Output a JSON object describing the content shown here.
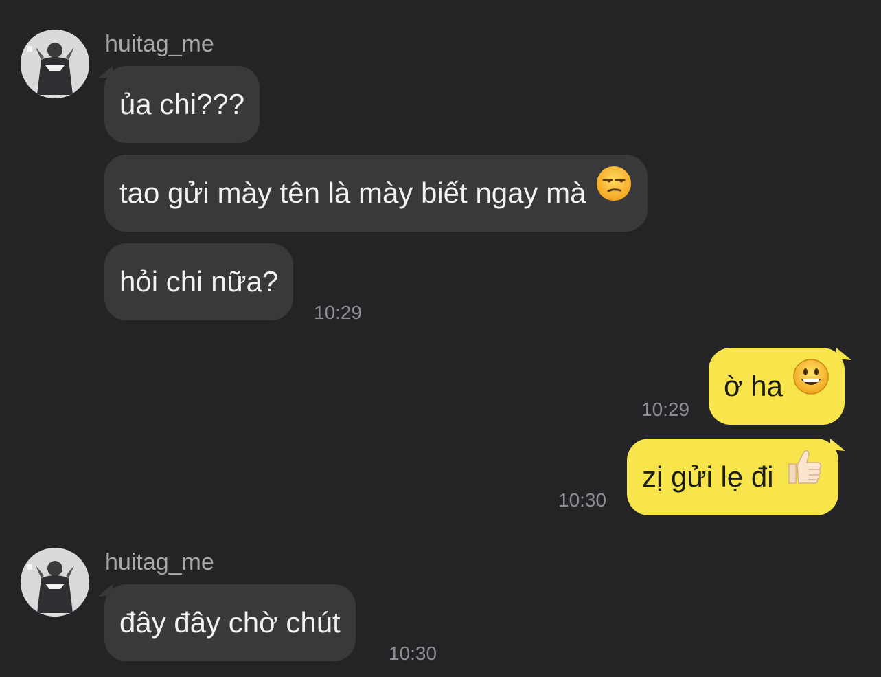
{
  "conversation": {
    "messages": [
      {
        "text": "ủa chi???"
      },
      {
        "text": "tao gửi mày tên là mày biết ngay mà"
      },
      {
        "text": "hỏi chi nữa?"
      },
      {
        "text": "ờ ha"
      },
      {
        "text": "zị gửi lẹ đi"
      },
      {
        "text": "đây đây chờ chút"
      }
    ],
    "groups": [
      {
        "sender": "huitag_me",
        "time": "10:29"
      },
      {
        "time": "10:29"
      },
      {
        "time": "10:30"
      },
      {
        "sender": "huitag_me",
        "time": "10:30"
      }
    ],
    "emojis": [
      "unamused-face-icon",
      "grinning-face-icon",
      "thumbs-up-icon"
    ]
  },
  "colors": {
    "background": "#242426",
    "incoming_bubble": "#39393c",
    "outgoing_bubble": "#f7e54b",
    "sender_text": "#a8a8ab",
    "timestamp_text": "#8e8e92"
  }
}
